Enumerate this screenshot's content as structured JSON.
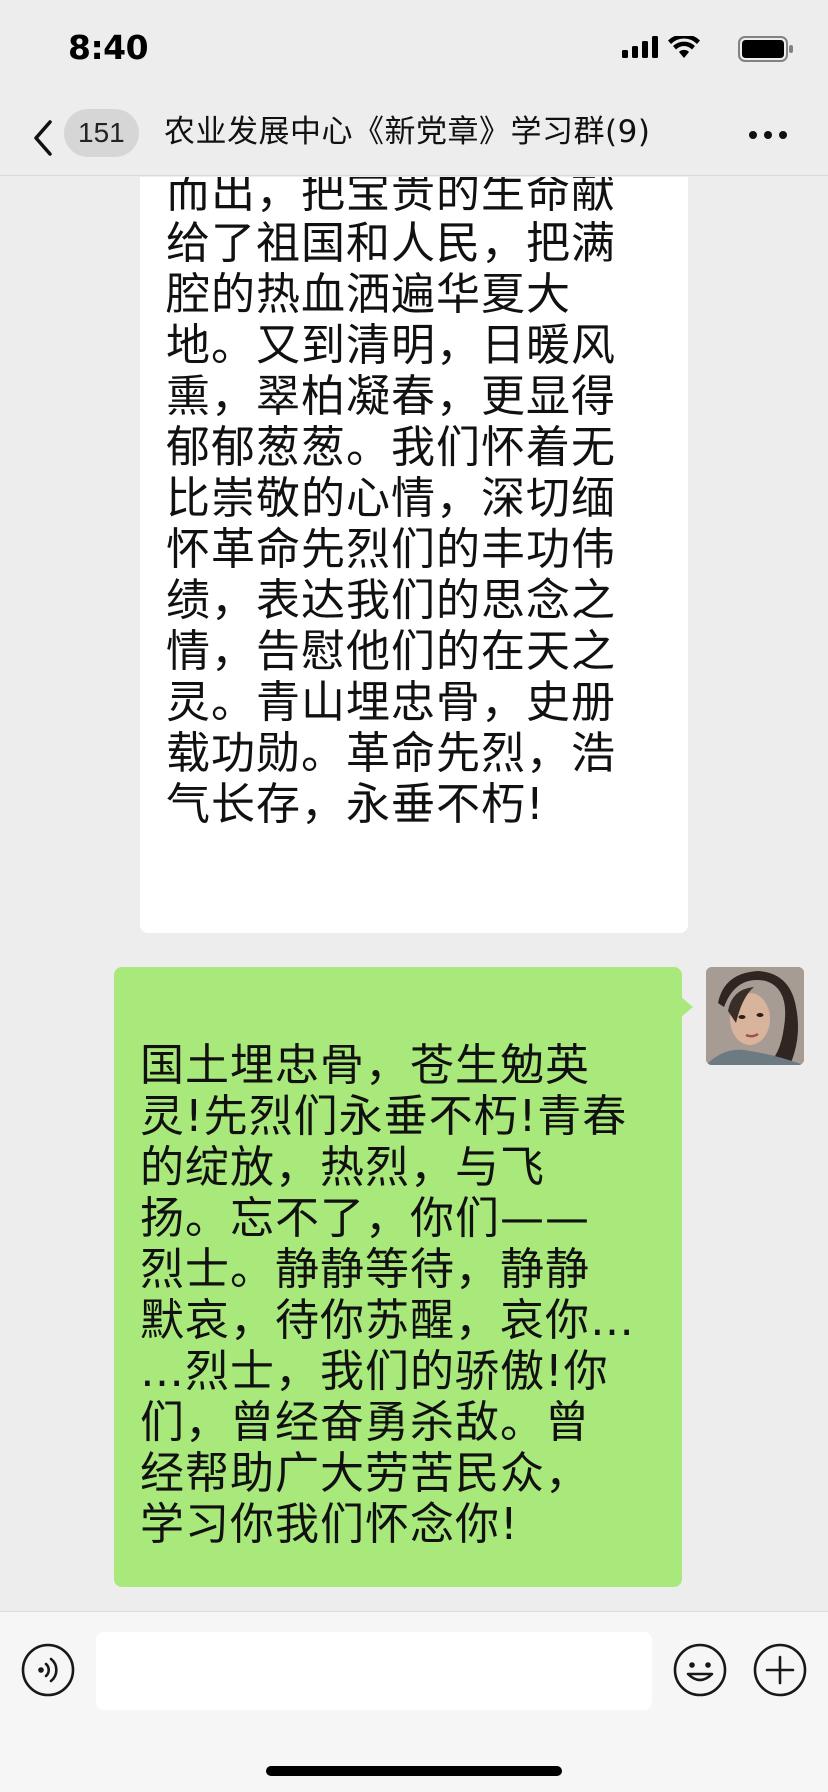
{
  "status_bar": {
    "time": "8:40"
  },
  "nav_bar": {
    "unread_count": "151",
    "title": "农业发展中心《新党章》学习群(9)"
  },
  "messages": [
    {
      "direction": "incoming",
      "text": "而出，把宝贵的生命献\n给了祖国和人民，把满\n腔的热血洒遍华夏大\n地。又到清明，日暖风\n熏，翠柏凝春，更显得\n郁郁葱葱。我们怀着无\n比崇敬的心情，深切缅\n怀革命先烈们的丰功伟\n绩，表达我们的思念之\n情，告慰他们的在天之\n灵。青山埋忠骨，史册\n载功勋。革命先烈，浩\n气长存，永垂不朽!"
    },
    {
      "direction": "outgoing",
      "text": "国土埋忠骨，苍生勉英\n灵!先烈们永垂不朽!青春\n的绽放，热烈，与飞\n扬。忘不了，你们——\n烈士。静静等待，静静\n默哀，待你苏醒，哀你…\n…烈士，我们的骄傲!你\n们，曾经奋勇杀敌。曾\n经帮助广大劳苦民众，\n学习你我们怀念你!"
    }
  ],
  "input_bar": {
    "value": ""
  },
  "colors": {
    "background": "#ededed",
    "outgoing_bubble": "#a9e97b",
    "incoming_bubble": "#ffffff"
  },
  "icons": {
    "back": "chevron-left-icon",
    "more": "more-dots-icon",
    "voice": "voice-icon",
    "emoji": "emoji-icon",
    "plus": "plus-icon"
  }
}
